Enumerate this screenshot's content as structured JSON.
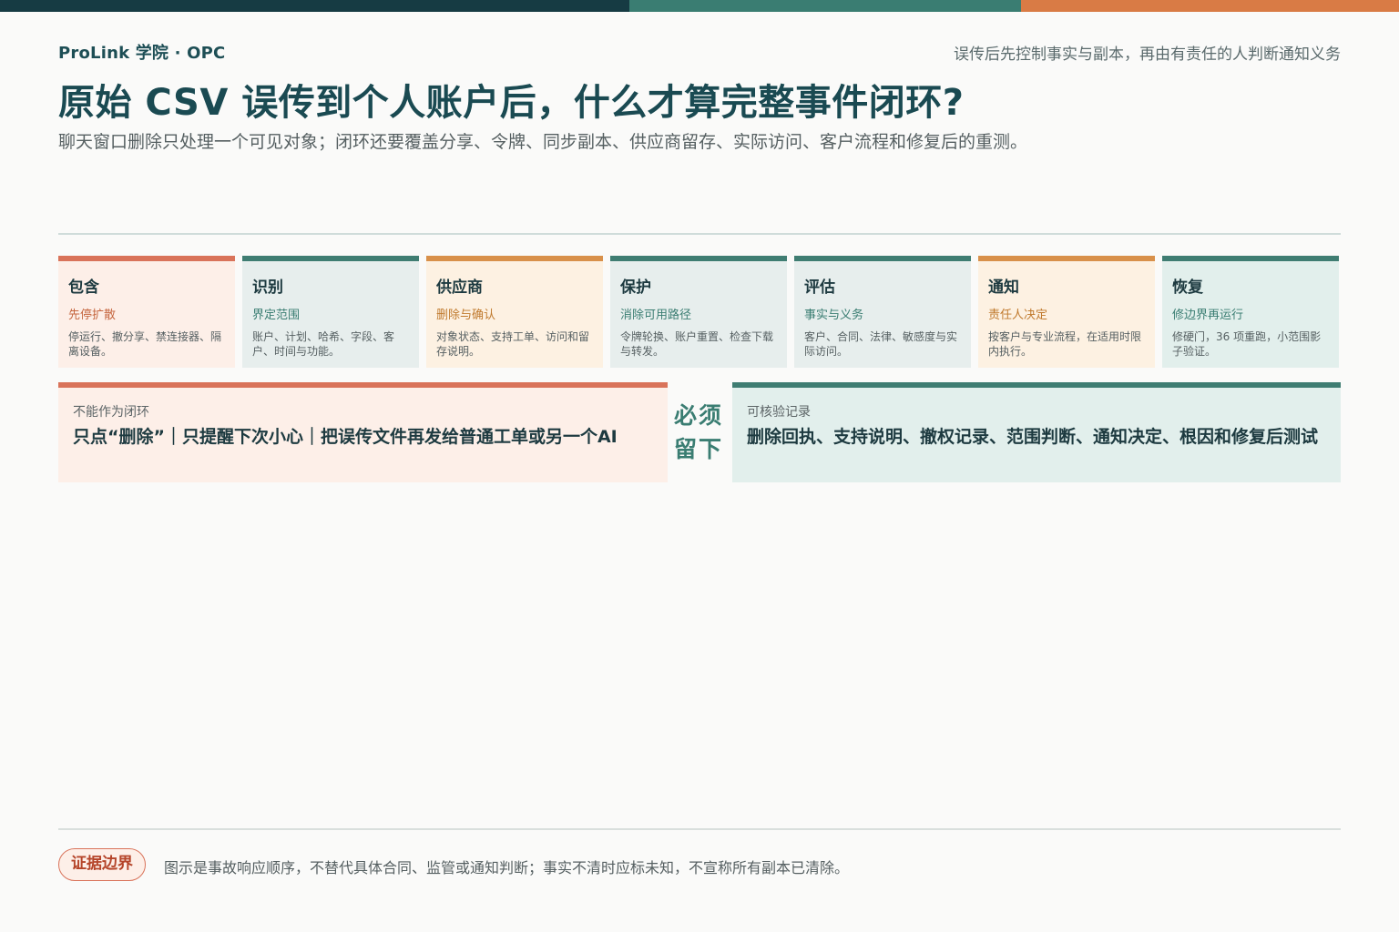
{
  "brand": "ProLink 学院 · OPC",
  "tagline": "误传后先控制事实与副本，再由有责任的人判断通知义务",
  "title": "原始 CSV 误传到个人账户后，什么才算完整事件闭环?",
  "subtitle": "聊天窗口删除只处理一个可见对象；闭环还要覆盖分享、令牌、同步副本、供应商留存、实际访问、客户流程和修复后的重测。",
  "colors": {
    "red": "#d9735a",
    "teal": "#3f7d72",
    "orange": "#d8904a",
    "dark": "#163b43"
  },
  "steps": [
    {
      "title": "包含",
      "subtitle": "先停扩散",
      "desc": "停运行、撤分享、禁连接器、隔离设备。",
      "color": "red"
    },
    {
      "title": "识别",
      "subtitle": "界定范围",
      "desc": "账户、计划、哈希、字段、客户、时间与功能。",
      "color": "teal"
    },
    {
      "title": "供应商",
      "subtitle": "删除与确认",
      "desc": "对象状态、支持工单、访问和留存说明。",
      "color": "orange"
    },
    {
      "title": "保护",
      "subtitle": "消除可用路径",
      "desc": "令牌轮换、账户重置、检查下载与转发。",
      "color": "teal"
    },
    {
      "title": "评估",
      "subtitle": "事实与义务",
      "desc": "客户、合同、法律、敏感度与实际访问。",
      "color": "teal"
    },
    {
      "title": "通知",
      "subtitle": "责任人决定",
      "desc": "按客户与专业流程，在适用时限内执行。",
      "color": "orange"
    },
    {
      "title": "恢复",
      "subtitle": "修边界再运行",
      "desc": "修硬门，36 项重跑，小范围影子验证。",
      "color": "mint"
    }
  ],
  "not_closure": {
    "label": "不能作为闭环",
    "text": "只点“删除”｜只提醒下次小心｜把误传文件再发给普通工单或另一个AI"
  },
  "center_word": "必须留下",
  "verifiable": {
    "label": "可核验记录",
    "text": "删除回执、支持说明、撤权记录、范围判断、通知决定、根因和修复后测试"
  },
  "footer": {
    "badge": "证据边界",
    "note": "图示是事故响应顺序，不替代具体合同、监管或通知判断；事实不清时应标未知，不宣称所有副本已清除。"
  }
}
